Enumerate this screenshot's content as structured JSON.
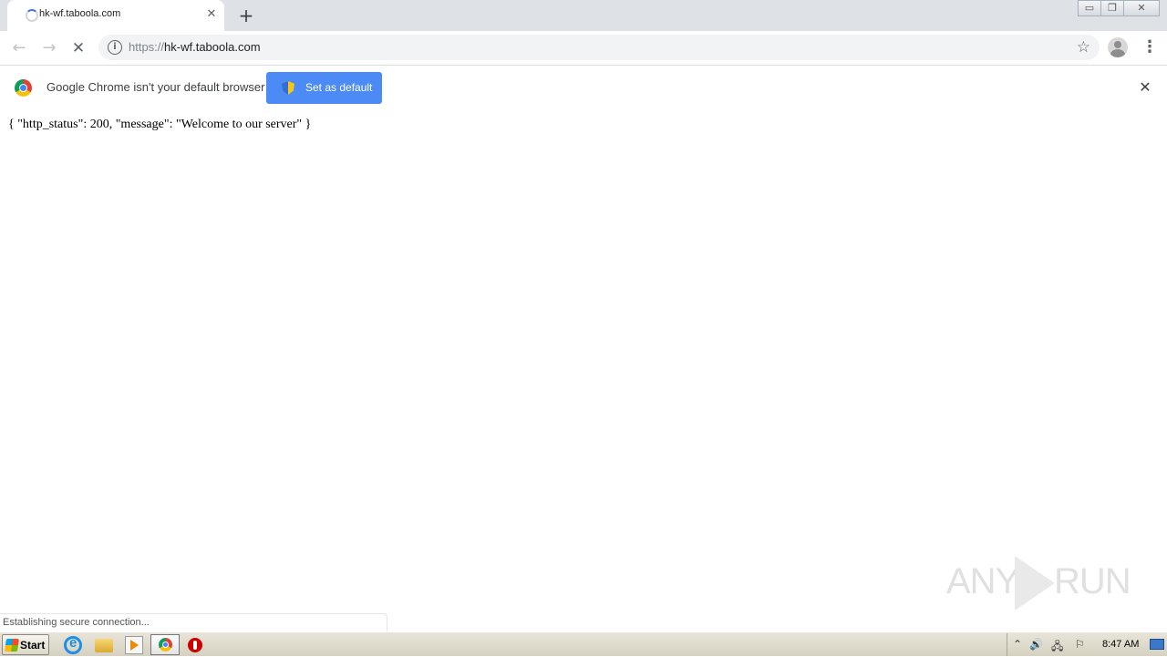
{
  "tab": {
    "title": "hk-wf.taboola.com",
    "close_glyph": "✕"
  },
  "newtab_glyph": "+",
  "window_controls": {
    "minimize": "▭",
    "restore": "❐",
    "close": "✕"
  },
  "nav": {
    "back": "←",
    "forward": "→",
    "stop": "✕"
  },
  "omnibox": {
    "scheme": "https://",
    "host": "hk-wf.taboola.com",
    "info_glyph": "i",
    "star": "☆"
  },
  "menu_glyph": "⋮",
  "infobar": {
    "message": "Google Chrome isn't your default browser",
    "button_label": "Set as default",
    "close_glyph": "✕"
  },
  "page": {
    "body_text": "{ \"http_status\": 200, \"message\": \"Welcome to our server\" }"
  },
  "watermark": {
    "left": "ANY",
    "right": "RUN"
  },
  "status": {
    "text": "Establishing secure connection..."
  },
  "taskbar": {
    "start_label": "Start",
    "tray_icons": [
      "⌃",
      "🔊",
      "🖧",
      "⚐"
    ],
    "clock": "8:47 AM"
  }
}
